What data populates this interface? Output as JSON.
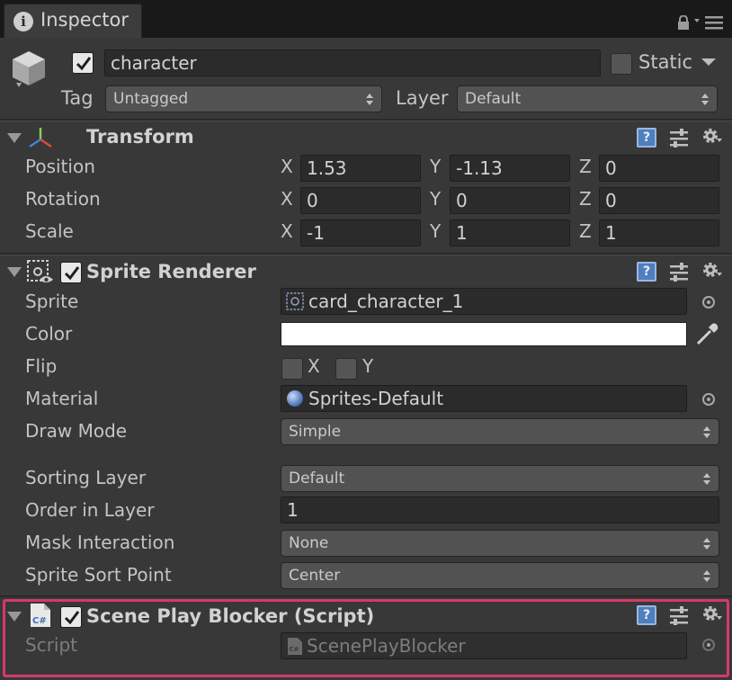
{
  "tab": {
    "title": "Inspector"
  },
  "header": {
    "active": true,
    "name": "character",
    "static_label": "Static",
    "static": false,
    "tag_label": "Tag",
    "tag_value": "Untagged",
    "layer_label": "Layer",
    "layer_value": "Default"
  },
  "transform": {
    "title": "Transform",
    "rows": [
      {
        "label": "Position",
        "x": "1.53",
        "y": "-1.13",
        "z": "0"
      },
      {
        "label": "Rotation",
        "x": "0",
        "y": "0",
        "z": "0"
      },
      {
        "label": "Scale",
        "x": "-1",
        "y": "1",
        "z": "1"
      }
    ],
    "axes": {
      "x": "X",
      "y": "Y",
      "z": "Z"
    }
  },
  "sprite_renderer": {
    "title": "Sprite Renderer",
    "enabled": true,
    "sprite_label": "Sprite",
    "sprite_value": "card_character_1",
    "color_label": "Color",
    "color_value": "#ffffff",
    "flip_label": "Flip",
    "flip_x_label": "X",
    "flip_y_label": "Y",
    "material_label": "Material",
    "material_value": "Sprites-Default",
    "draw_mode_label": "Draw Mode",
    "draw_mode_value": "Simple",
    "sorting_layer_label": "Sorting Layer",
    "sorting_layer_value": "Default",
    "order_label": "Order in Layer",
    "order_value": "1",
    "mask_label": "Mask Interaction",
    "mask_value": "None",
    "sort_point_label": "Sprite Sort Point",
    "sort_point_value": "Center"
  },
  "script_component": {
    "title": "Scene Play Blocker (Script)",
    "enabled": true,
    "script_label": "Script",
    "script_value": "ScenePlayBlocker",
    "file_icon_text": "C#"
  },
  "colors": {
    "highlight": "#d43a6a",
    "help_blue": "#4e7fbf"
  }
}
